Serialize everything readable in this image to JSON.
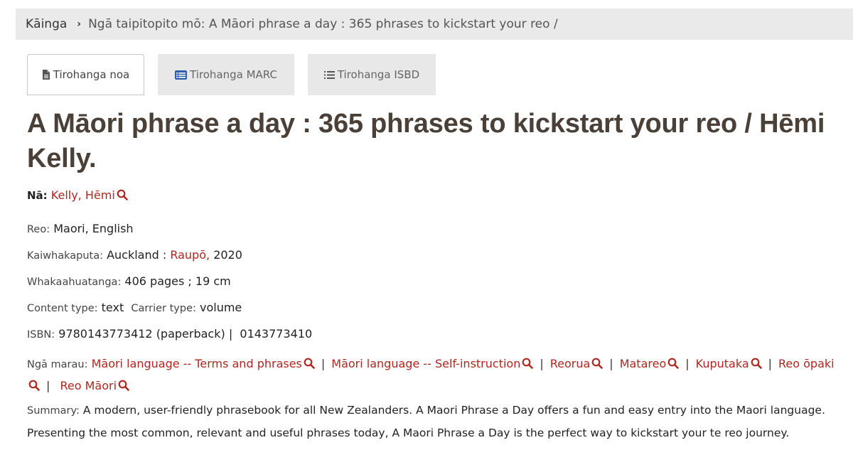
{
  "breadcrumb": {
    "home": "Kāinga",
    "current": "Ngā taipitopito mō: A Māori phrase a day : 365 phrases to kickstart your reo /"
  },
  "tabs": [
    {
      "label": "Tirohanga noa",
      "icon": "file-icon",
      "active": true
    },
    {
      "label": "Tirohanga MARC",
      "icon": "list-alt-icon",
      "active": false
    },
    {
      "label": "Tirohanga ISBD",
      "icon": "list-icon",
      "active": false
    }
  ],
  "record": {
    "title": "A Māori phrase a day : 365 phrases to kickstart your reo / Hēmi Kelly.",
    "author_label": "Nā:",
    "author": "Kelly, Hēmi",
    "language_label": "Reo:",
    "language": "Maori, English",
    "publisher_label": "Kaiwhakaputa:",
    "publisher_place": "Auckland :",
    "publisher": "Raupō,",
    "publisher_year": "2020",
    "description_label": "Whakaahuatanga:",
    "description": "406 pages ; 19 cm",
    "content_type_label": "Content type:",
    "content_type": "text",
    "carrier_type_label": "Carrier type:",
    "carrier_type": "volume",
    "isbn_label": "ISBN:",
    "isbn_1": "9780143773412 (paperback)",
    "isbn_sep": "|",
    "isbn_2": "0143773410",
    "subjects_label": "Ngā marau:",
    "subjects": [
      "Māori language -- Terms and phrases",
      "Māori language -- Self-instruction",
      "Reorua",
      "Matareo",
      "Kuputaka",
      "Reo ōpaki",
      "Reo Māori"
    ],
    "summary_label": "Summary:",
    "summary": "A modern, user-friendly phrasebook for all New Zealanders. A Maori Phrase a Day offers a fun and easy entry into the Maori language. Presenting the most common, relevant and useful phrases today, A Maori Phrase a Day is the perfect way to kickstart your te reo journey."
  },
  "colors": {
    "link": "#b0261f",
    "heading": "#4a4038",
    "breadcrumb_bg": "#eaeaea",
    "tab_inactive_bg": "#e8e8e8"
  }
}
